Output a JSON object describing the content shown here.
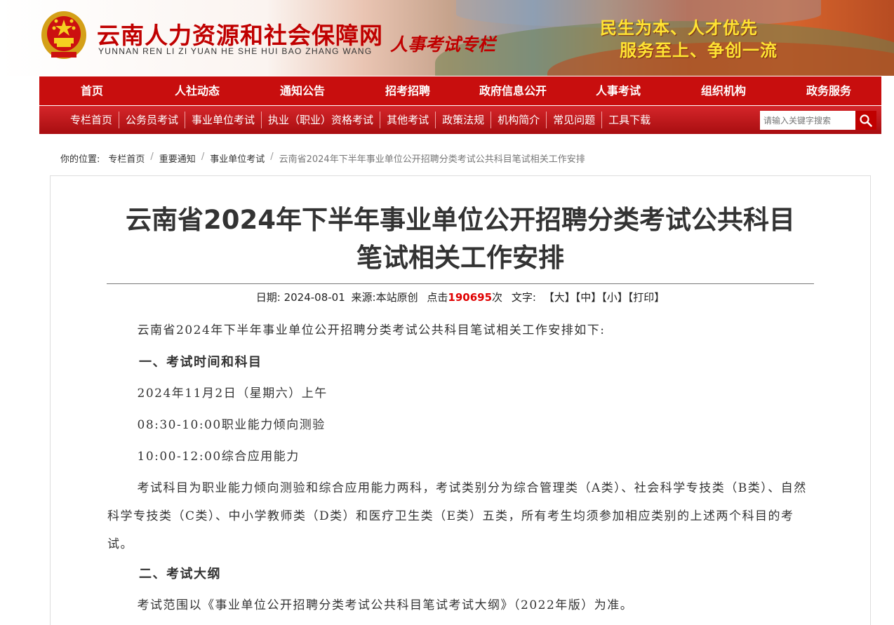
{
  "header": {
    "site_title": "云南人力资源和社会保障网",
    "site_subtitle": "YUNNAN REN LI ZI YUAN HE SHE HUI BAO ZHANG WANG",
    "column_title": "人事考试专栏",
    "slogan_line1": "民生为本、人才优先",
    "slogan_line2": "服务至上、争创一流"
  },
  "nav_main": [
    "首页",
    "人社动态",
    "通知公告",
    "招考招聘",
    "政府信息公开",
    "人事考试",
    "组织机构",
    "政务服务"
  ],
  "nav_sub": [
    "专栏首页",
    "公务员考试",
    "事业单位考试",
    "执业（职业）资格考试",
    "其他考试",
    "政策法规",
    "机构简介",
    "常见问题",
    "工具下载"
  ],
  "search": {
    "placeholder": "请输入关键字搜索"
  },
  "breadcrumb": {
    "label": "你的位置:",
    "items": [
      "专栏首页",
      "重要通知",
      "事业单位考试"
    ],
    "current": "云南省2024年下半年事业单位公开招聘分类考试公共科目笔试相关工作安排"
  },
  "article": {
    "title_line1": "云南省2024年下半年事业单位公开招聘分类考试公共科目",
    "title_line2": "笔试相关工作安排",
    "meta": {
      "date_label": "日期:",
      "date": "2024-08-01",
      "source_label": "来源:",
      "source": "本站原创",
      "hits_prefix": "点击",
      "hits": "190695",
      "hits_suffix": "次",
      "font_label": "文字:",
      "font_large": "【大】",
      "font_medium": "【中】",
      "font_small": "【小】",
      "print": "【打印】"
    },
    "intro": "云南省2024年下半年事业单位公开招聘分类考试公共科目笔试相关工作安排如下:",
    "section1_heading": "一、考试时间和科目",
    "section1_date": "2024年11月2日（星期六）上午",
    "section1_slot1": "08:30-10:00职业能力倾向测验",
    "section1_slot2": "10:00-12:00综合应用能力",
    "section1_para": "考试科目为职业能力倾向测验和综合应用能力两科，考试类别分为综合管理类（A类）、社会科学专技类（B类）、自然科学专技类（C类）、中小学教师类（D类）和医疗卫生类（E类）五类，所有考生均须参加相应类别的上述两个科目的考试。",
    "section2_heading": "二、考试大纲",
    "section2_para": "考试范围以《事业单位公开招聘分类考试公共科目笔试考试大纲》（2022年版）为准。"
  },
  "colors": {
    "brand_red": "#c80e0e",
    "hits_red": "#e00000",
    "slogan_yellow": "#ffe433"
  }
}
